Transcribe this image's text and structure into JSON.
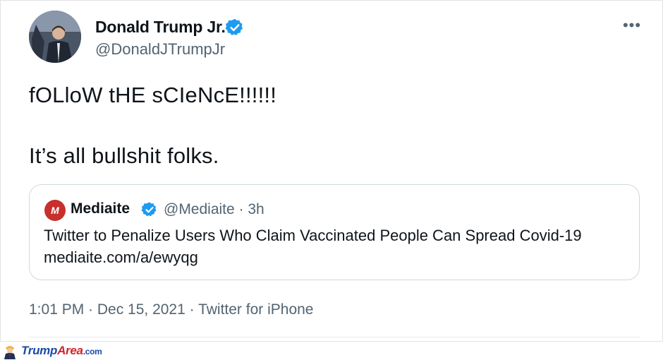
{
  "tweet": {
    "display_name": "Donald Trump Jr.",
    "handle": "@DonaldJTrumpJr",
    "verified_icon": "verified-badge-icon",
    "more_icon": "more-options-icon",
    "more_label": "•••",
    "text_line1": "fOLloW tHE sCIeNcE!!!!!!",
    "text_line2": "It’s all bullshit folks.",
    "timestamp": "1:01 PM · Dec 15, 2021 · ",
    "source": "Twitter for iPhone"
  },
  "quoted_tweet": {
    "avatar_letter": "M",
    "name": "Mediaite",
    "handle_time": "@Mediaite · 3h",
    "headline": "Twitter to Penalize Users Who Claim Vaccinated People Can Spread Covid-19",
    "link": "mediaite.com/a/ewyqg"
  },
  "watermark": {
    "brand_part1": "Trump",
    "brand_part2": "Area",
    "brand_suffix": ".com"
  },
  "colors": {
    "verified_blue": "#1d9bf0",
    "secondary_text": "#536471",
    "mediaite_red": "#c7302c"
  }
}
